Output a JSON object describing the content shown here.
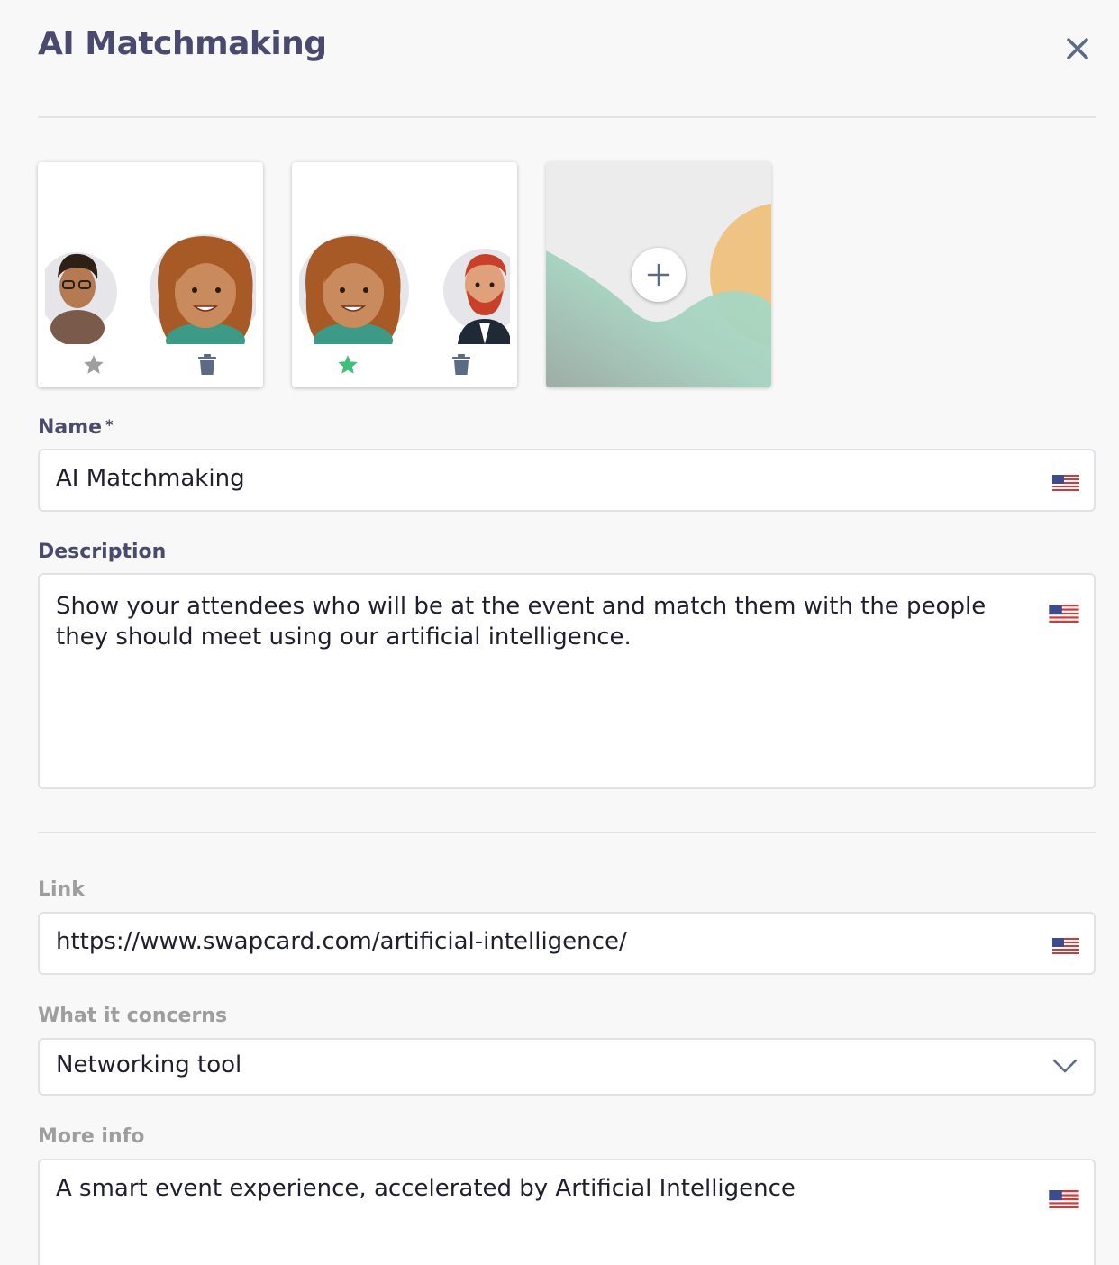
{
  "header": {
    "title": "AI Matchmaking"
  },
  "icons": {
    "close": "close-icon",
    "star": "star-icon",
    "trash": "trash-icon",
    "add": "plus-icon",
    "flag": "us-flag-icon",
    "chevron": "chevron-down-icon"
  },
  "colors": {
    "primary_text": "#4a4a6e",
    "star_active": "#3fc07a",
    "star_inactive": "#9e9e9e",
    "trash": "#5b6b86"
  },
  "images": [
    {
      "favorite": false
    },
    {
      "favorite": true
    }
  ],
  "form": {
    "name": {
      "label": "Name",
      "required_mark": "*",
      "value": "AI Matchmaking"
    },
    "description": {
      "label": "Description",
      "value": "Show your attendees who will be at the event and match them with the people they should meet using our artificial intelligence."
    },
    "link": {
      "label": "Link",
      "value": "https://www.swapcard.com/artificial-intelligence/"
    },
    "concerns": {
      "label": "What it concerns",
      "value": "Networking tool"
    },
    "more_info": {
      "label": "More info",
      "value": "A smart event experience, accelerated by Artificial Intelligence"
    }
  }
}
